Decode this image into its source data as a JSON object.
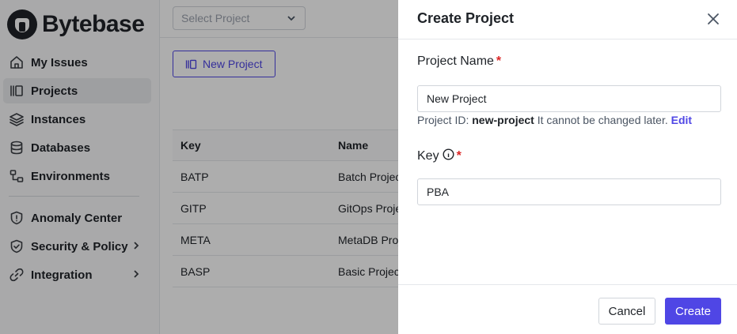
{
  "app": {
    "name": "Bytebase"
  },
  "sidebar": {
    "items": [
      {
        "label": "My Issues",
        "icon": "home-icon"
      },
      {
        "label": "Projects",
        "icon": "projects-icon",
        "active": true
      },
      {
        "label": "Instances",
        "icon": "layers-icon"
      },
      {
        "label": "Databases",
        "icon": "database-icon"
      },
      {
        "label": "Environments",
        "icon": "environments-icon"
      },
      {
        "label": "Anomaly Center",
        "icon": "shield-icon"
      },
      {
        "label": "Security & Policy",
        "icon": "shield-check-icon",
        "expandable": true
      },
      {
        "label": "Integration",
        "icon": "link-icon",
        "expandable": true
      }
    ]
  },
  "topbar": {
    "project_select_placeholder": "Select Project"
  },
  "projects_page": {
    "new_project_label": "New Project",
    "table": {
      "columns": [
        "Key",
        "Name"
      ],
      "rows": [
        {
          "key": "BATP",
          "name": "Batch Project"
        },
        {
          "key": "GITP",
          "name": "GitOps Project"
        },
        {
          "key": "META",
          "name": "MetaDB Project"
        },
        {
          "key": "BASP",
          "name": "Basic Project"
        }
      ]
    }
  },
  "drawer": {
    "title": "Create Project",
    "project_name_label": "Project Name",
    "required_mark": "*",
    "project_name_value": "New Project",
    "project_id_prefix": "Project ID:",
    "project_id_value": "new-project",
    "project_id_note": "It cannot be changed later.",
    "edit_link": "Edit",
    "key_label": "Key",
    "key_value": "PBA",
    "cancel_label": "Cancel",
    "create_label": "Create"
  },
  "colors": {
    "accent": "#4f46e5",
    "required": "#dc2626",
    "overlay": "rgba(0,0,0,0.32)"
  }
}
